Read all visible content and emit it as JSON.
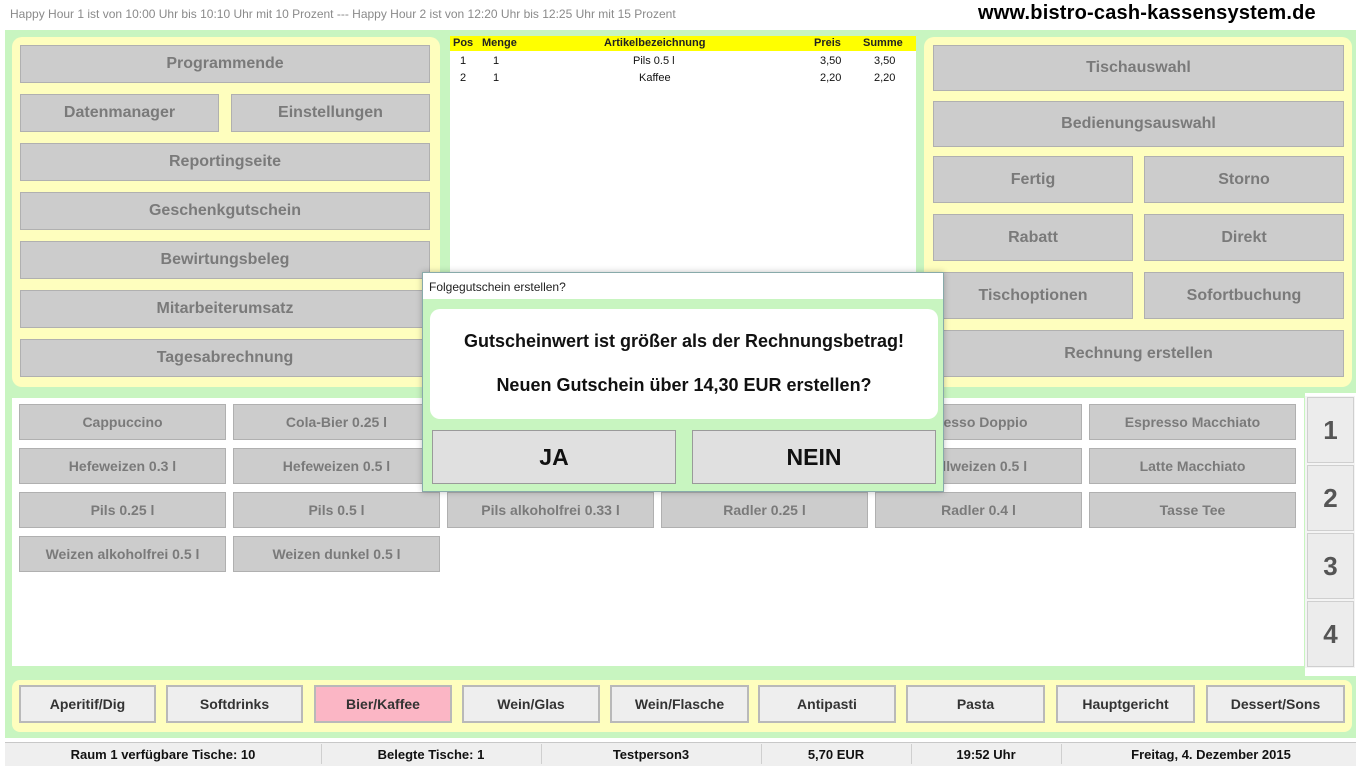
{
  "header": {
    "ticker": "Happy Hour 1 ist von 10:00 Uhr bis 10:10 Uhr mit 10 Prozent --- Happy Hour 2 ist von 12:20 Uhr bis 12:25 Uhr mit 15 Prozent",
    "website": "www.bistro-cash-kassensystem.de"
  },
  "left_menu": {
    "programmende": "Programmende",
    "datenmanager": "Datenmanager",
    "einstellungen": "Einstellungen",
    "reportingseite": "Reportingseite",
    "geschenkgutschein": "Geschenkgutschein",
    "bewirtungsbeleg": "Bewirtungsbeleg",
    "mitarbeiterumsatz": "Mitarbeiterumsatz",
    "tagesabrechnung": "Tagesabrechnung"
  },
  "order_table": {
    "headers": {
      "pos": "Pos",
      "menge": "Menge",
      "artikel": "Artikelbezeichnung",
      "preis": "Preis",
      "summe": "Summe"
    },
    "rows": [
      {
        "pos": "1",
        "menge": "1",
        "artikel": "Pils 0.5 l",
        "preis": "3,50",
        "summe": "3,50"
      },
      {
        "pos": "2",
        "menge": "1",
        "artikel": "Kaffee",
        "preis": "2,20",
        "summe": "2,20"
      }
    ]
  },
  "right_menu": {
    "tischauswahl": "Tischauswahl",
    "bedienungsauswahl": "Bedienungsauswahl",
    "fertig": "Fertig",
    "storno": "Storno",
    "rabatt": "Rabatt",
    "direkt": "Direkt",
    "tischoptionen": "Tischoptionen",
    "sofortbuchung": "Sofortbuchung",
    "rechnung_erstellen": "Rechnung erstellen"
  },
  "products": [
    [
      "Cappuccino",
      "Cola-Bier 0.25 l",
      "",
      "",
      "presso Doppio",
      "Espresso Macchiato"
    ],
    [
      "Hefeweizen 0.3 l",
      "Hefeweizen 0.5 l",
      "",
      "",
      "tallweizen 0.5 l",
      "Latte Macchiato"
    ],
    [
      "Pils 0.25 l",
      "Pils 0.5 l",
      "Pils alkoholfrei 0.33 l",
      "Radler 0.25 l",
      "Radler 0.4 l",
      "Tasse Tee"
    ],
    [
      "Weizen alkoholfrei 0.5 l",
      "Weizen dunkel 0.5 l"
    ]
  ],
  "pages": [
    "1",
    "2",
    "3",
    "4"
  ],
  "categories": [
    "Aperitif/Dig",
    "Softdrinks",
    "Bier/Kaffee",
    "Wein/Glas",
    "Wein/Flasche",
    "Antipasti",
    "Pasta",
    "Hauptgericht",
    "Dessert/Sons"
  ],
  "active_category": "Bier/Kaffee",
  "status": {
    "raum": "Raum 1 verfügbare Tische: 10",
    "belegte": "Belegte Tische: 1",
    "person": "Testperson3",
    "betrag": "5,70 EUR",
    "zeit": "19:52 Uhr",
    "datum": "Freitag, 4. Dezember 2015"
  },
  "dialog": {
    "title": "Folgegutschein erstellen?",
    "line1": "Gutscheinwert ist größer als der Rechnungsbetrag!",
    "line2": "Neuen Gutschein über 14,30 EUR erstellen?",
    "yes": "JA",
    "no": "NEIN"
  },
  "colors": {
    "frame_green": "#c8f5c0",
    "panel_yellow": "#fefebe",
    "button_gray": "#cccccc",
    "table_header_yellow": "#ffff00",
    "active_category_pink": "#fbb6c5"
  }
}
